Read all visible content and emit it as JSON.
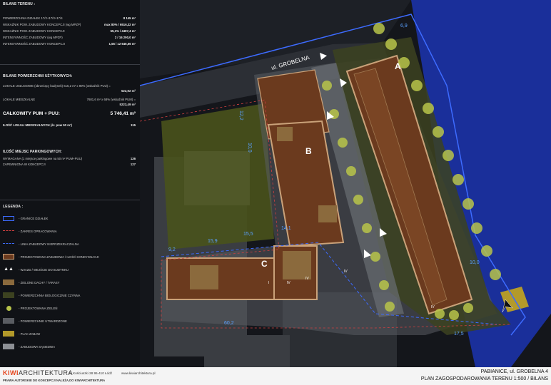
{
  "bilans_terenu": {
    "title": "BILANS TERENU :",
    "rows": [
      {
        "label": "POWIERZCHNIA DZIAŁEK 17/2+17/3+17/4",
        "value": "8 145 m²"
      },
      {
        "label": "WSKAŹNIK POW. ZABUDOWY KONCEPCJI (wg MPZP)",
        "value": "max 80% / 6516,32 m²"
      },
      {
        "label": "WSKAŹNIK POW. ZABUDOWY KONCEPCJI",
        "value": "55,1% / 4487,4 m²"
      },
      {
        "label": "INTENSYWNOŚĆ ZABUDOWY (wg MPZP)",
        "value": "2 / 16 290,0 m²"
      },
      {
        "label": "INTENSYWNOŚĆ ZABUDOWY KONCEPCJI",
        "value": "1,55 / 12 646,56 m²"
      }
    ]
  },
  "bilans_pow": {
    "title": "BILANS POWIERZCHNI UŻYTKOWYCH:",
    "uslugowe_label": "LOKALE USŁUGOWE (obrzeżący budynek) 615,2 m² x 90% (wskaźnik PUU) =",
    "uslugowe_value": "522,92 m²",
    "mieszkalne_label": "LOKALE MIESZKALNE",
    "mieszkalne_formula": "7681,6 m² x 68% (wskaźnik PUM) =",
    "mieszkalne_value": "5223,49 m²",
    "total_label": "CAŁKOWITY PUM + PUU:",
    "total_value": "5 746,41 m²",
    "lokale_label": "ILOŚĆ LOKALI MIESZKALNYCH (śr. pow 50 m²)",
    "lokale_value": "115"
  },
  "parking": {
    "title": "ILOŚĆ MIEJSC PARKINGOWYCH:",
    "rows": [
      {
        "label": "WYMAGANA (1 miejsce parkingowe na 50 m² PUM+PUU)",
        "value": "126"
      },
      {
        "label": "ZAPEWNIONA W KONCEPCJI",
        "value": "127"
      }
    ]
  },
  "legend": {
    "title": "LEGENDA :",
    "items": [
      {
        "label": "- GRANICE DZIAŁEK"
      },
      {
        "label": "- ZAKRES OPRACOWANIA"
      },
      {
        "label": "- LINIA ZABUDOWY NIEPRZEKRACZALNA"
      },
      {
        "label": "- PROJEKTOWANA ZABUDOWA / ILOŚĆ KONDYGNACJI"
      },
      {
        "label": "- WJAZD / WEJŚCIE DO BUDYNKU"
      },
      {
        "label": "- ZIELONE DACHY / TARASY"
      },
      {
        "label": "- POWIERZCHNIA BIOLOGICZNIE CZYNNA"
      },
      {
        "label": "- PROJEKTOWANA ZIELEŃ"
      },
      {
        "label": "- POWIERZCHNIE UTWARDZONE"
      },
      {
        "label": "- PLAC ZABAW"
      },
      {
        "label": "- ZABUDOWA SĄSIEDNIA"
      }
    ]
  },
  "footer": {
    "logo_kiwi": "KIWI",
    "logo_rest": "ARCHITEKTURA",
    "address": "ul. Kościuszki 28 95-410 Łódź",
    "website": "www.kiwiarchitektura.pl",
    "copyright": "PRAWA AUTORSKIE DO KONCEPCJI NALEŻĄ DO KIWIARCHITEKTURA",
    "location": "PABIANICE, ul. GROBELNA 4",
    "plan_title": "PLAN ZAGOSPODAROWANIA TERENU 1:500 / BILANS"
  },
  "map": {
    "street": "ul. GROBELNA",
    "building_a": "A",
    "building_b": "B",
    "building_c": "C",
    "dims": [
      "15,9",
      "9,2",
      "15,5",
      "14,1",
      "60,2",
      "17,5",
      "10,0",
      "10,0",
      "12,2",
      "6,9"
    ],
    "floors": [
      "IV",
      "IV",
      "IV",
      "IV",
      "I"
    ]
  },
  "colors": {
    "accent": "#e8c24a",
    "brown": "#6b3a1e",
    "green": "#49521c",
    "blue": "#1b3a8a",
    "water": "#1a2f9a"
  }
}
